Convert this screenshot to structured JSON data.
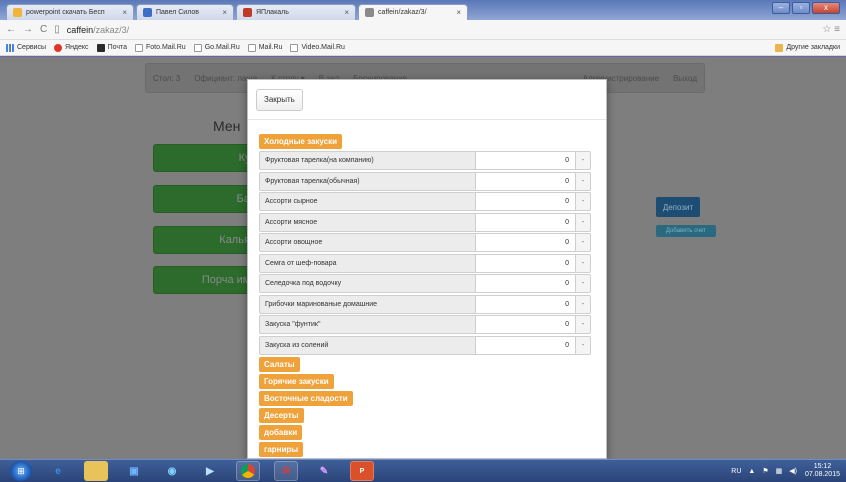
{
  "browser": {
    "tabs": [
      {
        "label": "powerpoint скачать Бесп",
        "fav_color": "#f0b33b",
        "active": false
      },
      {
        "label": "Павел Силов",
        "fav_color": "#3b6ec4",
        "active": false
      },
      {
        "label": "ЯПлакаль",
        "fav_color": "#c0392b",
        "active": false
      },
      {
        "label": "caffein/zakaz/3/",
        "fav_color": "#8a8a8a",
        "active": true
      }
    ],
    "url_host": "caffein",
    "url_path": "/zakaz/3/",
    "bookmarks": [
      "Сервисы",
      "Яндекс",
      "Почта",
      "Foto.Mail.Ru",
      "Go.Mail.Ru",
      "Mail.Ru",
      "Video.Mail.Ru"
    ],
    "other_bookmarks": "Другие закладки"
  },
  "page": {
    "nav": [
      "Стол: 3",
      "Официант: паша",
      "К столу ▾",
      "В зал",
      "Бронирование"
    ],
    "nav_right": [
      "Администрирование",
      "Выход"
    ],
    "menu_title": "Мен",
    "green_buttons": [
      "Кух",
      "Бар",
      "Кальян",
      "Порча иму"
    ],
    "deposit": "Депозит",
    "add_account": "Добавить счет"
  },
  "modal": {
    "close_label": "Закрыть",
    "open_category": "Холодные закуски",
    "items": [
      {
        "name": "Фруктовая тарелка(на компанию)",
        "qty": "0"
      },
      {
        "name": "Фруктовая тарелка(обычная)",
        "qty": "0"
      },
      {
        "name": "Ассорти сырное",
        "qty": "0"
      },
      {
        "name": "Ассорти мясное",
        "qty": "0"
      },
      {
        "name": "Ассорти овощное",
        "qty": "0"
      },
      {
        "name": "Семга от шеф-повара",
        "qty": "0"
      },
      {
        "name": "Селедочка под водочку",
        "qty": "0"
      },
      {
        "name": "Грибочки маринованые домашние",
        "qty": "0"
      },
      {
        "name": "Закуска \"фунтик\"",
        "qty": "0"
      },
      {
        "name": "Закуска из солений",
        "qty": "0"
      }
    ],
    "minus_label": "-",
    "other_categories": [
      "Салаты",
      "Горячие закуски",
      "Восточные сладости",
      "Десерты",
      "добавки",
      "гарниры"
    ]
  },
  "taskbar": {
    "lang": "RU",
    "time": "15:12",
    "date": "07.08.2015"
  },
  "colors": {
    "category_orange": "#efa13a",
    "button_green": "#2c6b2c",
    "deposit_blue": "#1e4d73"
  }
}
